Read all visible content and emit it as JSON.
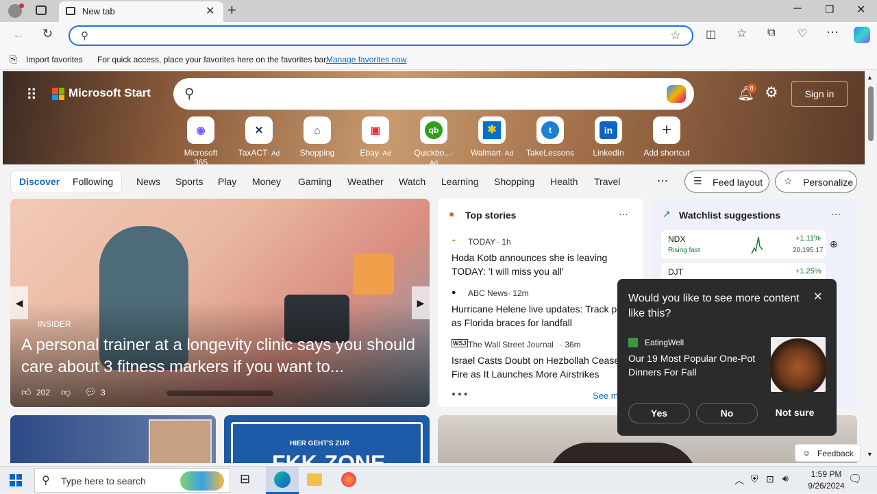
{
  "browser": {
    "tab_title": "New tab",
    "favorites_import": "Import favorites",
    "favorites_hint": "For quick access, place your favorites here on the favorites bar.",
    "favorites_manage": "Manage favorites now"
  },
  "msstart": {
    "brand": "Microsoft Start",
    "sign_in": "Sign in",
    "notif_count": "8",
    "shortcuts": [
      {
        "label": "Microsoft 365",
        "ad": ""
      },
      {
        "label": "TaxACT",
        "ad": "· Ad"
      },
      {
        "label": "Shopping",
        "ad": ""
      },
      {
        "label": "Ebay",
        "ad": "· Ad"
      },
      {
        "label": "Quickbo...",
        "ad": "· Ad"
      },
      {
        "label": "Walmart",
        "ad": "· Ad"
      },
      {
        "label": "TakeLessons",
        "ad": ""
      },
      {
        "label": "LinkedIn",
        "ad": ""
      },
      {
        "label": "Add shortcut",
        "ad": ""
      }
    ],
    "tabs": {
      "discover": "Discover",
      "following": "Following"
    },
    "nav": [
      "News",
      "Sports",
      "Play",
      "Money",
      "Gaming",
      "Weather",
      "Watch",
      "Learning",
      "Shopping",
      "Health",
      "Travel"
    ],
    "feed_layout": "Feed layout",
    "personalize": "Personalize"
  },
  "feature": {
    "source": "INSIDER",
    "headline": "A personal trainer at a longevity clinic says you should care about 3 fitness markers if you want to...",
    "likes": "202",
    "comments": "3"
  },
  "top_stories": {
    "title": "Top stories",
    "see_more": "See m",
    "items": [
      {
        "source": "TODAY",
        "time": "· 1h",
        "title": "Hoda Kotb announces she is leaving TODAY: 'I will miss you all'"
      },
      {
        "source": "ABC News",
        "time": "· 12m",
        "title": "Hurricane Helene live updates: Track pa as Florida braces for landfall"
      },
      {
        "source": "The Wall Street Journal",
        "time": "· 36m",
        "title": "Israel Casts Doubt on Hezbollah Cease Fire as It Launches More Airstrikes"
      }
    ]
  },
  "watchlist": {
    "title": "Watchlist suggestions",
    "items": [
      {
        "symbol": "NDX",
        "status": "Rising fast",
        "change": "+1.11%",
        "price": "20,195.17"
      },
      {
        "symbol": "DJT",
        "status": "",
        "change": "+1.25%",
        "price": ""
      }
    ]
  },
  "popup": {
    "question": "Would you like to see more content like this?",
    "source": "EatingWell",
    "article": "Our 19 Most Popular One-Pot Dinners For Fall",
    "yes": "Yes",
    "no": "No",
    "not_sure": "Not sure"
  },
  "feedback": "Feedback",
  "bottom_card": {
    "text": "HIER GEHT'S ZUR",
    "text2": "FKK-ZONE"
  },
  "taskbar": {
    "search_placeholder": "Type here to search",
    "time": "1:59 PM",
    "date": "9/26/2024"
  },
  "colors": {
    "accent": "#0f6cbd",
    "positive": "#0a7a2f"
  }
}
